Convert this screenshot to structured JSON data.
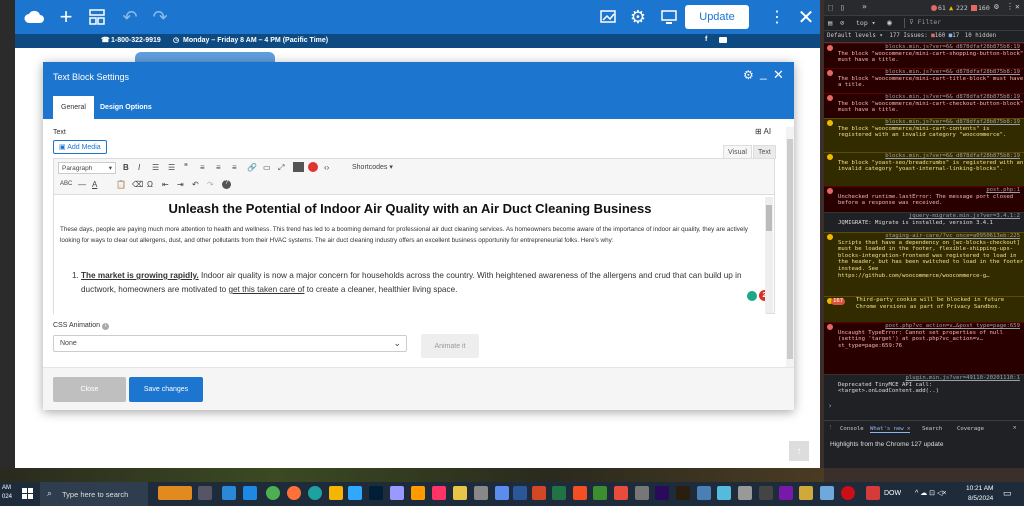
{
  "editor_bar": {
    "update_label": "Update"
  },
  "site_topbar": {
    "phone": "1-800-322-9919",
    "hours": "Monday – Friday 8 AM – 4 PM (Pacific Time)"
  },
  "modal": {
    "title": "Text Block Settings",
    "tabs": [
      "General",
      "Design Options"
    ],
    "text_label": "Text",
    "ai_label": "AI",
    "add_media_label": "Add Media",
    "view_tabs": [
      "Visual",
      "Text"
    ],
    "format_select": "Paragraph",
    "shortcodes_label": "Shortcodes",
    "badge_count": "2",
    "content": {
      "heading": "Unleash the Potential of Indoor Air Quality with an Air Duct Cleaning Business",
      "paragraph": "These days, people are paying much more attention to health and wellness. This trend has led to a booming demand for professional air duct cleaning services. As homeowners become aware of the importance of indoor air quality, they are actively looking for ways to clear out allergens, dust, and other pollutants from their HVAC systems. The air duct cleaning industry offers an excellent business opportunity for entrepreneurial folks. Here's why:",
      "list_item_bold": "The market is growing rapidly.",
      "list_item_text_1": " Indoor air quality is now a major concern for households across the country. With heightened awareness of the allergens and crud that can build up in ductwork, homeowners are motivated to ",
      "list_item_underlined": "get this taken care of",
      "list_item_text_2": " to create a cleaner, healthier living space."
    },
    "css_animation_label": "CSS Animation",
    "css_animation_value": "None",
    "animate_label": "Animate it",
    "close_label": "Close",
    "save_label": "Save changes"
  },
  "devtools": {
    "errors_count": "61",
    "warnings_count": "222",
    "info_count": "160",
    "context": "top",
    "filter_placeholder": "Filter",
    "default_levels": "Default levels",
    "issues_label": "177 Issues:",
    "issues_errors": "160",
    "issues_warnings": "17",
    "hidden_label": "10 hidden",
    "cookie_badge": "167",
    "drawer_tabs": [
      "Console",
      "What's new",
      "Search",
      "Coverage"
    ],
    "drawer_text": "Highlights from the Chrome 127 update",
    "rows": [
      {
        "kind": "err",
        "link": "blocks.min.js?ver=6&_d878dfaf28b875b8:19",
        "text": "The block \"woocommerce/mini-cart-shopping-button-block\" must have a title."
      },
      {
        "kind": "err",
        "link": "blocks.min.js?ver=6&_d878dfaf28b875b8:19",
        "text": "The block \"woocommerce/mini-cart-title-block\" must have a title."
      },
      {
        "kind": "err",
        "link": "blocks.min.js?ver=6&_d878dfaf28b875b8:19",
        "text": "The block \"woocommerce/mini-cart-checkout-button-block\" must have a title."
      },
      {
        "kind": "warn",
        "link": "blocks.min.js?ver=6&_d878dfaf28b875b8:19",
        "text": "The block \"woocommerce/mini-cart-contents\" is registered with an invalid category \"woocommerce\"."
      },
      {
        "kind": "warn",
        "link": "blocks.min.js?ver=6&_d878dfaf28b875b8:19",
        "text": "The block \"yoast-seo/breadcrumbs\" is registered with an invalid category \"yoast-internal-linking-blocks\"."
      },
      {
        "kind": "err",
        "link": "post.php:1",
        "text": "Unchecked runtime.lastError: The message port closed before a response was received."
      },
      {
        "kind": "info",
        "link": "jquery-migrate.min.js?ver=3.4.1:2",
        "text": "JQMIGRATE: Migrate is installed, version 3.4.1"
      },
      {
        "kind": "warn",
        "link": "staging-air-care/?vc_once=a0950613eb:225",
        "text": "Scripts that have a dependency on [wc-blocks-checkout] must be loaded in the footer, flexible-shipping-ups-blocks-integration-frontend was registered to load in the header, but has been switched to load in the footer instead. See https://github.com/woocommerce/woocommerce-g…"
      },
      {
        "kind": "warn",
        "link": "",
        "text": "Third-party cookie will be blocked in future Chrome versions as part of Privacy Sandbox."
      },
      {
        "kind": "err",
        "link": "post.php?vc_action=v…&post_type=page:659",
        "text": "Uncaught TypeError: Cannot set properties of null (setting 'target') at post.php?vc_action=v…st_type=page:659:76"
      },
      {
        "kind": "info",
        "link": "plugin.min.js?ver=49110-20201110:1",
        "text": "Deprecated TinyMCE API call: <target>.onLoadContent.add(..)"
      }
    ]
  },
  "taskbar": {
    "search_placeholder": "Type here to search",
    "left_time": "AM",
    "left_year": "024",
    "stock": "DOW",
    "time": "10:21 AM",
    "date": "8/5/2024"
  },
  "colors": {
    "wp_blue": "#1c75cf",
    "dark_navy": "#0d4a82",
    "error_red": "#d93025"
  }
}
